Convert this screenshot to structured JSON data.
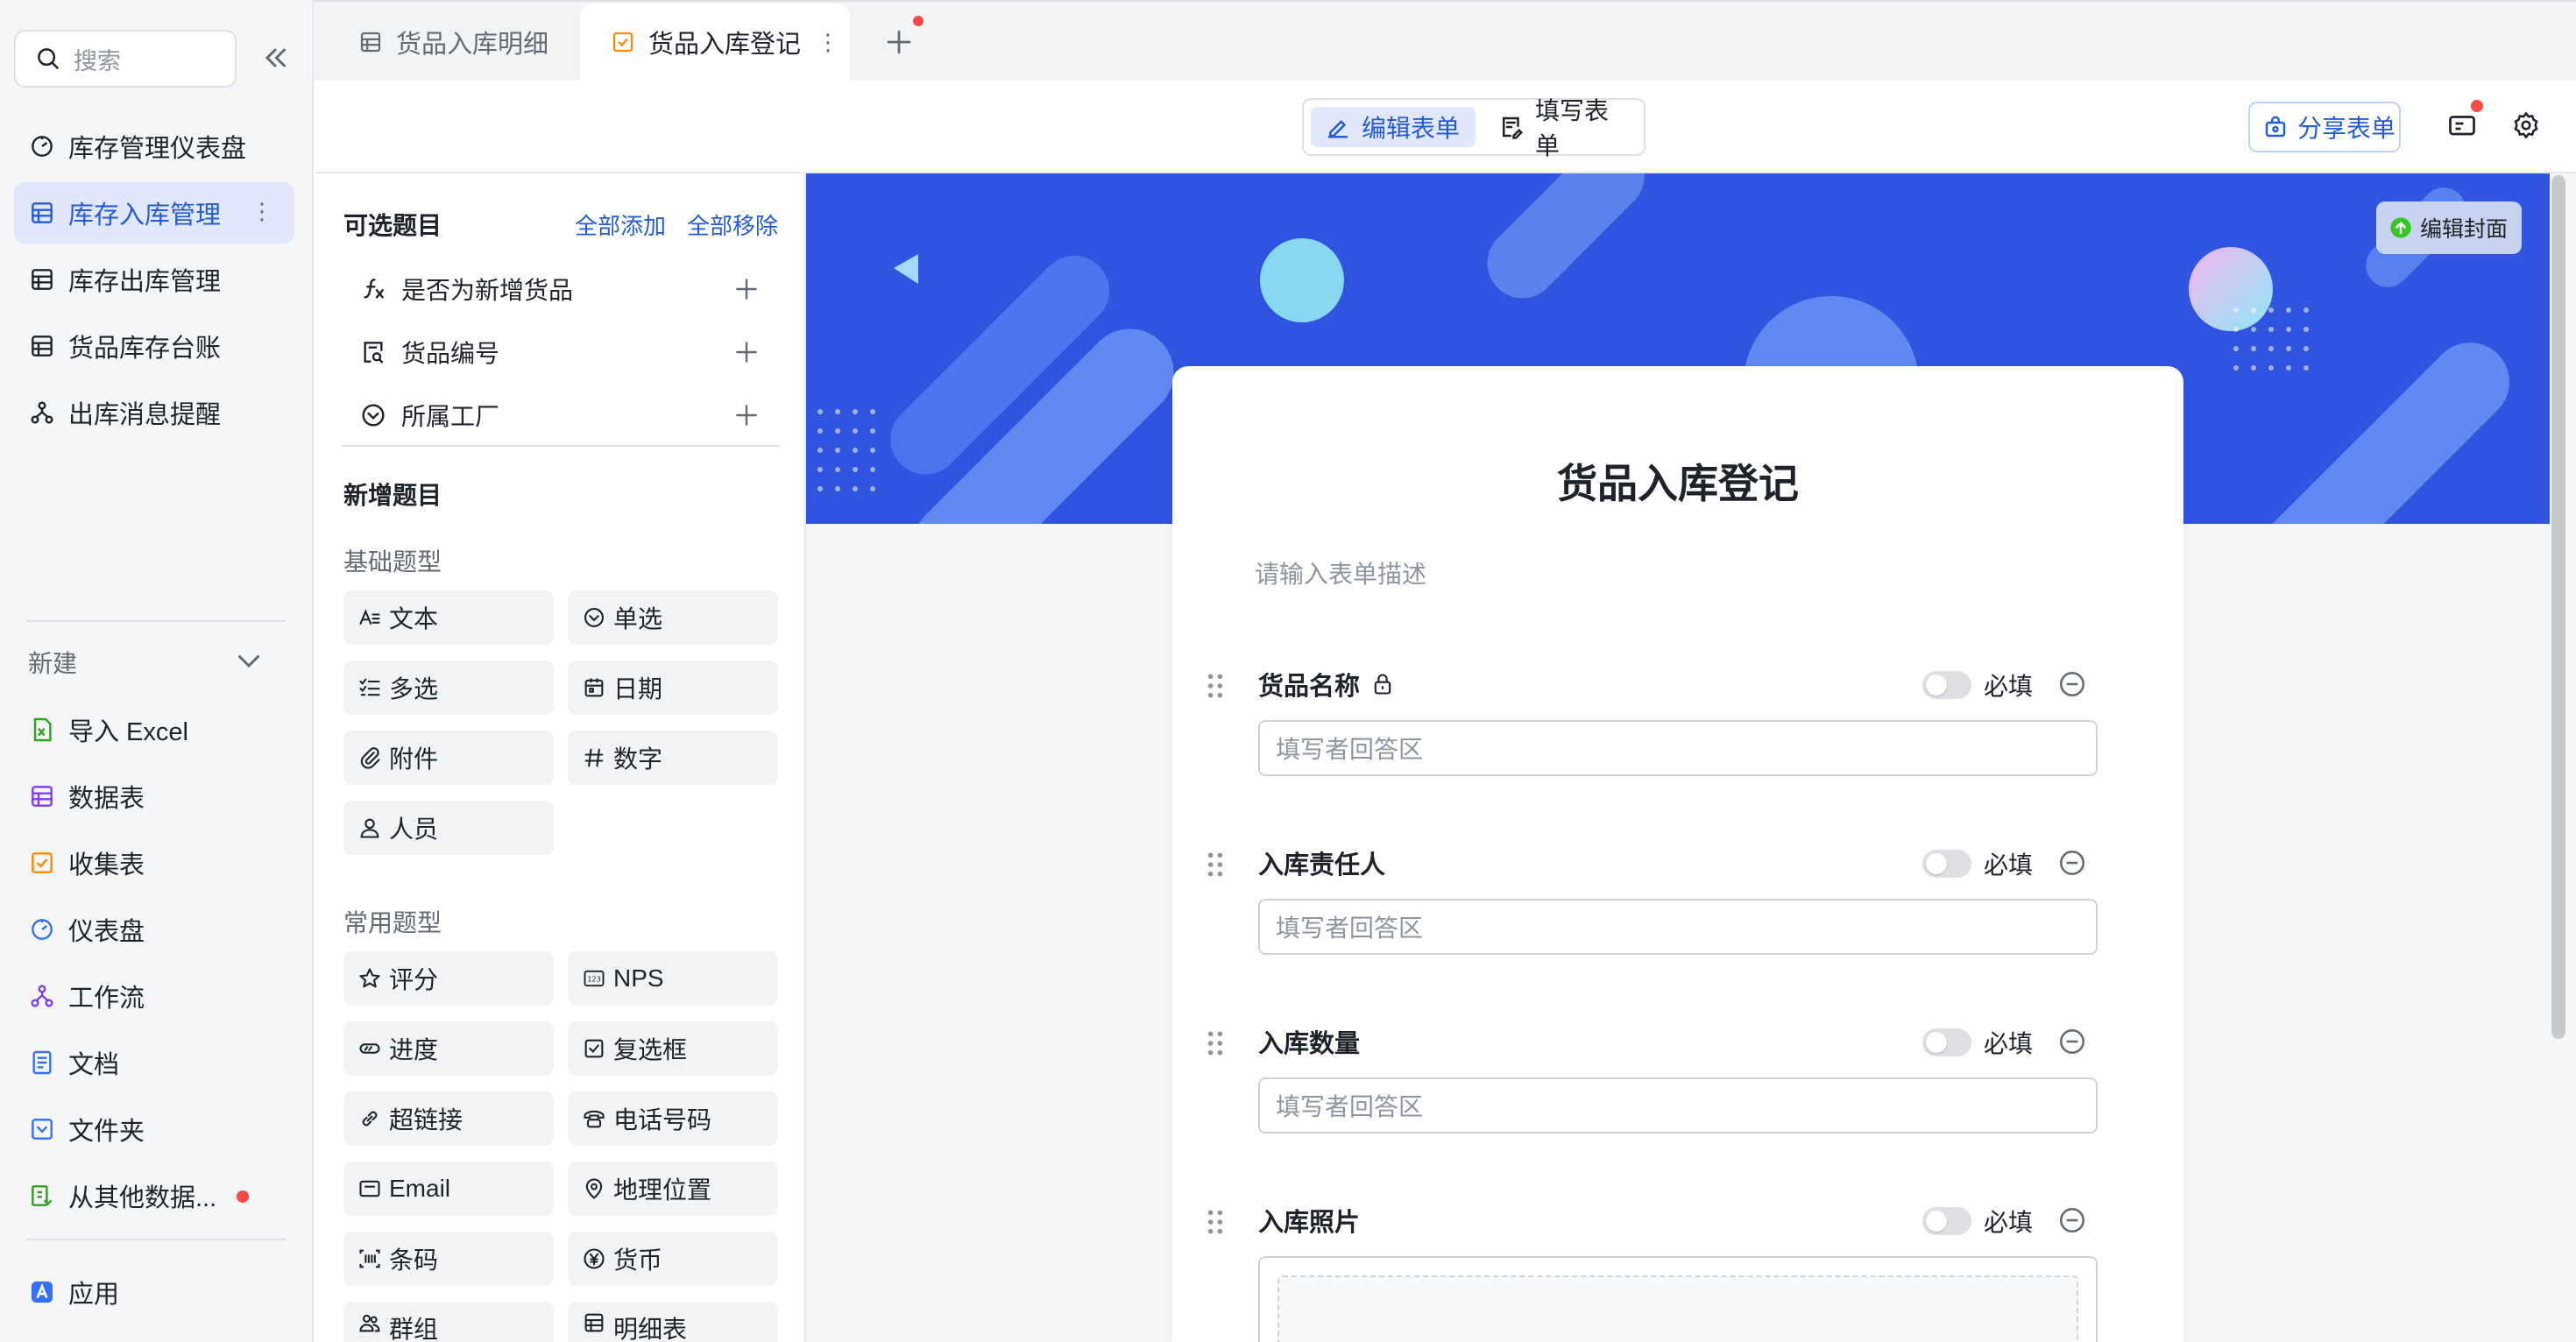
{
  "search": {
    "placeholder": "搜索"
  },
  "sidebar": {
    "items": [
      {
        "label": "库存管理仪表盘",
        "icon": "dashboard-icon"
      },
      {
        "label": "库存入库管理",
        "icon": "table-icon",
        "active": true
      },
      {
        "label": "库存出库管理",
        "icon": "table-icon"
      },
      {
        "label": "货品库存台账",
        "icon": "table-icon"
      },
      {
        "label": "出库消息提醒",
        "icon": "workflow-icon"
      }
    ],
    "new_label": "新建",
    "new_items": [
      {
        "label": "导入 Excel",
        "icon": "excel-icon",
        "color": "#2ea121"
      },
      {
        "label": "数据表",
        "icon": "table-icon",
        "color": "#7f3bf5"
      },
      {
        "label": "收集表",
        "icon": "form-icon",
        "color": "#ff8800"
      },
      {
        "label": "仪表盘",
        "icon": "dashboard-icon",
        "color": "#3370ff"
      },
      {
        "label": "工作流",
        "icon": "workflow-icon",
        "color": "#7f3bf5"
      },
      {
        "label": "文档",
        "icon": "doc-icon",
        "color": "#3370ff"
      },
      {
        "label": "文件夹",
        "icon": "folder-icon",
        "color": "#3370ff"
      },
      {
        "label": "从其他数据...",
        "icon": "sync-icon",
        "color": "#2ea121"
      }
    ],
    "app_label": "应用"
  },
  "tabs": [
    {
      "label": "货品入库明细",
      "icon": "table-icon"
    },
    {
      "label": "货品入库登记",
      "icon": "form-icon",
      "active": true
    }
  ],
  "toolbar": {
    "edit_label": "编辑表单",
    "fill_label": "填写表单",
    "share_label": "分享表单"
  },
  "question_panel": {
    "optional_title": "可选题目",
    "add_all": "全部添加",
    "remove_all": "全部移除",
    "optional_fields": [
      {
        "label": "是否为新增货品",
        "icon": "formula-icon"
      },
      {
        "label": "货品编号",
        "icon": "auto-number-icon"
      },
      {
        "label": "所属工厂",
        "icon": "single-select-icon"
      }
    ],
    "new_title": "新增题目",
    "basic_title": "基础题型",
    "basic_types": [
      {
        "label": "文本",
        "icon": "text-icon"
      },
      {
        "label": "单选",
        "icon": "single-select-icon"
      },
      {
        "label": "多选",
        "icon": "multi-select-icon"
      },
      {
        "label": "日期",
        "icon": "calendar-icon"
      },
      {
        "label": "附件",
        "icon": "attachment-icon"
      },
      {
        "label": "数字",
        "icon": "number-icon"
      },
      {
        "label": "人员",
        "icon": "person-icon"
      }
    ],
    "common_title": "常用题型",
    "common_types": [
      {
        "label": "评分",
        "icon": "star-icon"
      },
      {
        "label": "NPS",
        "icon": "nps-icon"
      },
      {
        "label": "进度",
        "icon": "progress-icon"
      },
      {
        "label": "复选框",
        "icon": "checkbox-icon"
      },
      {
        "label": "超链接",
        "icon": "link-icon"
      },
      {
        "label": "电话号码",
        "icon": "phone-icon"
      },
      {
        "label": "Email",
        "icon": "email-icon"
      },
      {
        "label": "地理位置",
        "icon": "location-icon"
      },
      {
        "label": "条码",
        "icon": "barcode-icon"
      },
      {
        "label": "货币",
        "icon": "currency-icon"
      },
      {
        "label": "群组",
        "icon": "group-icon"
      },
      {
        "label": "明细表",
        "icon": "table-icon"
      }
    ]
  },
  "form": {
    "cover_label": "编辑封面",
    "title": "货品入库登记",
    "description_placeholder": "请输入表单描述",
    "required_label": "必填",
    "answer_placeholder": "填写者回答区",
    "questions": [
      {
        "label": "货品名称",
        "locked": true,
        "type": "text"
      },
      {
        "label": "入库责任人",
        "type": "text"
      },
      {
        "label": "入库数量",
        "type": "text"
      },
      {
        "label": "入库照片",
        "type": "attachment"
      }
    ]
  },
  "colors": {
    "accent": "#245bdb",
    "banner": "#3054e0",
    "notify": "#f54a45"
  }
}
